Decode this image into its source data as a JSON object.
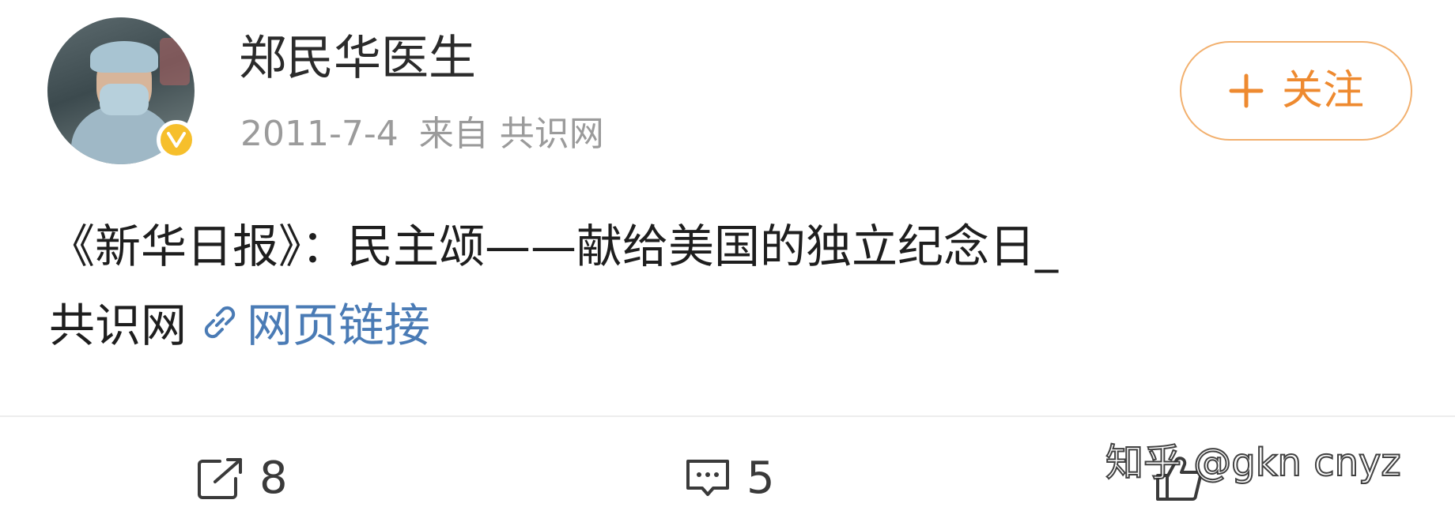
{
  "post": {
    "author": {
      "name": "郑民华医生",
      "verified": true,
      "badge_color": "#f6bf2c"
    },
    "meta": {
      "date": "2011-7-4",
      "source": "来自 共识网"
    },
    "follow_button": {
      "plus": "+",
      "label": "关注",
      "color": "#ee8a30"
    },
    "content": {
      "line1": "《新华日报》：民主颂——献给美国的独立纪念日_",
      "line2": "共识网",
      "link_label": "网页链接",
      "link_color": "#4a7bb5"
    },
    "actions": {
      "repost": {
        "icon": "share-icon",
        "count": "8"
      },
      "comment": {
        "icon": "comment-icon",
        "count": "5"
      },
      "like": {
        "icon": "thumbs-up-icon",
        "count": ""
      }
    },
    "watermark": "知乎 @gkn cnyz"
  }
}
